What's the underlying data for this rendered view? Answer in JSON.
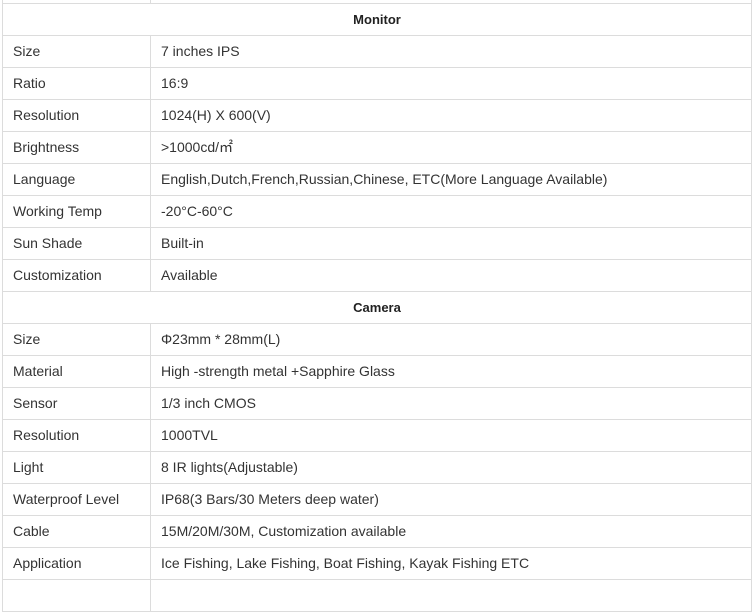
{
  "sections": [
    {
      "title": "Monitor",
      "rows": [
        {
          "label": "Size",
          "value": "7 inches IPS"
        },
        {
          "label": "Ratio",
          "value": "16:9"
        },
        {
          "label": "Resolution",
          "value": "1024(H) X 600(V)"
        },
        {
          "label": "Brightness",
          "value": ">1000cd/㎡"
        },
        {
          "label": "Language",
          "value": "English,Dutch,French,Russian,Chinese, ETC(More Language Available)"
        },
        {
          "label": "Working Temp",
          "value": "-20°C-60°C"
        },
        {
          "label": "Sun Shade",
          "value": "Built-in"
        },
        {
          "label": "Customization",
          "value": "Available"
        }
      ]
    },
    {
      "title": "Camera",
      "rows": [
        {
          "label": "Size",
          "value": "Φ23mm * 28mm(L)"
        },
        {
          "label": "Material",
          "value": "High -strength metal +Sapphire Glass"
        },
        {
          "label": "Sensor",
          "value": "1/3 inch CMOS"
        },
        {
          "label": "Resolution",
          "value": "1000TVL"
        },
        {
          "label": "Light",
          "value": "8 IR lights(Adjustable)"
        },
        {
          "label": "Waterproof Level",
          "value": "IP68(3 Bars/30 Meters deep water)"
        },
        {
          "label": "Cable",
          "value": "15M/20M/30M, Customization available"
        },
        {
          "label": "Application",
          "value": "Ice Fishing, Lake Fishing, Boat Fishing, Kayak Fishing ETC"
        }
      ]
    }
  ]
}
